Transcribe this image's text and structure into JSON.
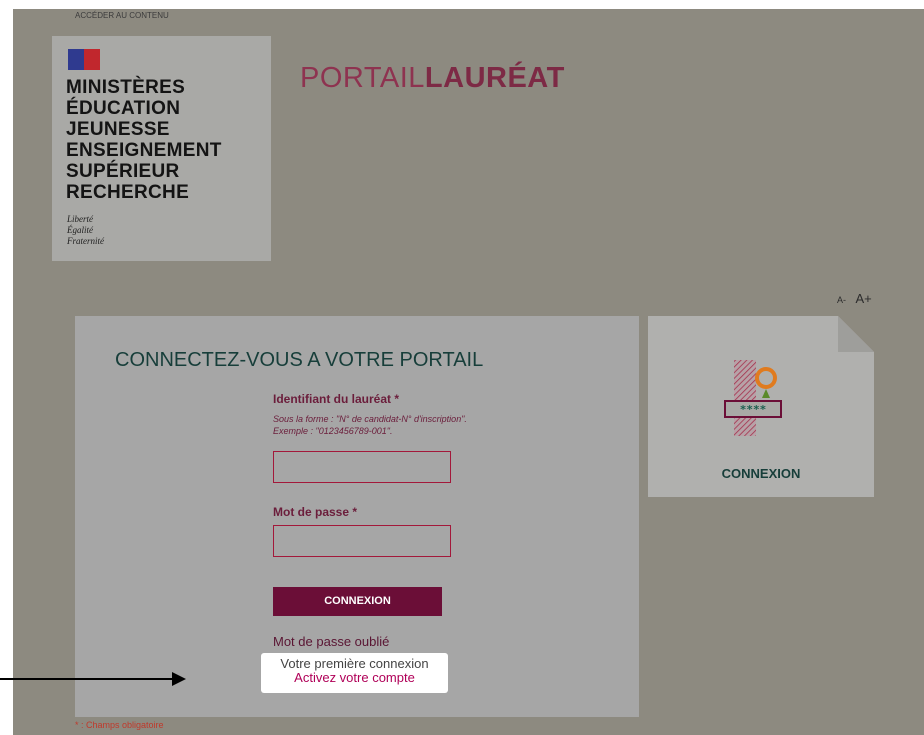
{
  "header": {
    "skip_link": "ACCÉDER AU CONTENU",
    "ministry_lines": [
      "MINISTÈRES",
      "ÉDUCATION",
      "JEUNESSE",
      "ENSEIGNEMENT",
      "SUPÉRIEUR",
      "RECHERCHE"
    ],
    "motto_lines": [
      "Liberté",
      "Égalité",
      "Fraternité"
    ],
    "portal_title_part1": "PORTAIL",
    "portal_title_part2": "LAURÉAT"
  },
  "font_controls": {
    "decrease": "A-",
    "increase": "A+"
  },
  "login": {
    "title": "CONNECTEZ-VOUS A VOTRE PORTAIL",
    "identifier_label": "Identifiant du lauréat *",
    "identifier_hint_line1": "Sous la forme : \"N° de candidat-N° d'inscription\".",
    "identifier_hint_line2": "Exemple : \"0123456789-001\".",
    "identifier_value": "",
    "password_label": "Mot de passe *",
    "password_value": "",
    "submit_label": "CONNEXION",
    "forgot_password": "Mot de passe oublié",
    "first_connection_text": "Votre première connexion",
    "activate_account": "Activez votre compte"
  },
  "required_note": "* : Champs obligatoire",
  "side_card": {
    "label": "CONNEXION",
    "icon": "password-key-icon",
    "icon_text": "****"
  },
  "colors": {
    "overlay": "#8d8a80",
    "accent": "#6b0e37",
    "title_green": "#173e3a",
    "link": "#b00058"
  }
}
